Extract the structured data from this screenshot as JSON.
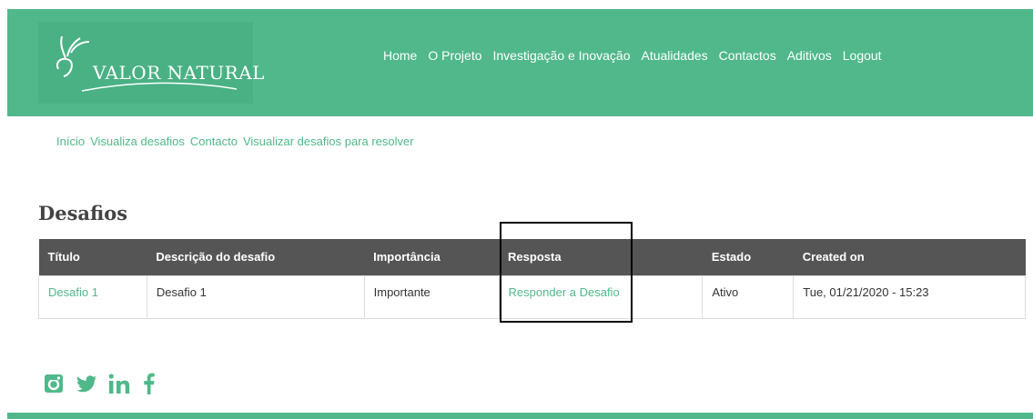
{
  "header": {
    "logo_text": "VALOR NATURAL",
    "bg_color": "#50b88a"
  },
  "nav": {
    "items": [
      "Home",
      "O Projeto",
      "Investigação e Inovação",
      "Atualidades",
      "Contactos",
      "Aditivos",
      "Logout"
    ]
  },
  "breadcrumb": {
    "items": [
      "Início",
      "Visualiza desafios",
      "Contacto",
      "Visualizar desafios para resolver"
    ]
  },
  "main": {
    "title": "Desafios",
    "table": {
      "headers": [
        "Título",
        "Descrição do desafio",
        "Importância",
        "Resposta",
        "Estado",
        "Created on"
      ],
      "rows": [
        [
          "Desafio 1",
          "Desafio 1",
          "Importante",
          "Responder a Desafio",
          "Ativo",
          "Tue, 01/21/2020 - 15:23"
        ]
      ]
    }
  },
  "social": {
    "icons": [
      "instagram-icon",
      "twitter-icon",
      "linkedin-icon",
      "facebook-icon"
    ],
    "color": "#50b88a"
  }
}
